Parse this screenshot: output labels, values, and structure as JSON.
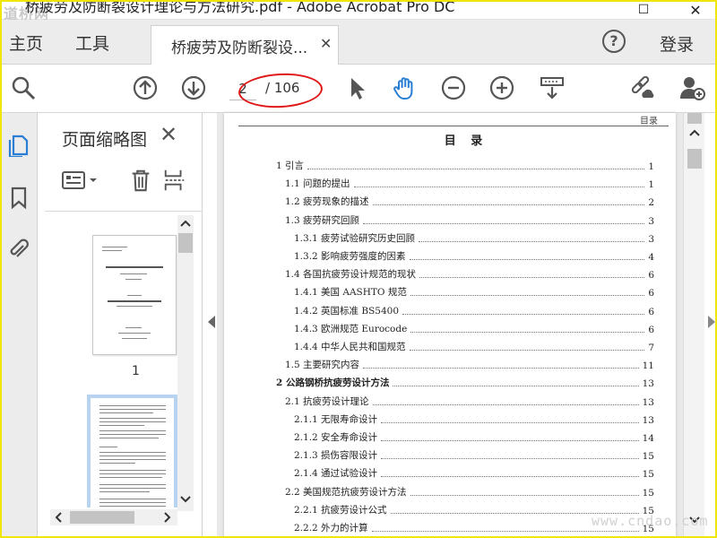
{
  "window": {
    "title": "桥疲劳及防断裂设计理论与方法研究.pdf - Adobe Acrobat Pro DC",
    "watermark_logo": "道桥网"
  },
  "tabs": {
    "home": "主页",
    "tools": "工具",
    "document_tab": "桥疲劳及防断裂设...",
    "login": "登录"
  },
  "toolbar": {
    "current_page": "2",
    "total_pages": "/ 106",
    "icons": [
      "search-icon",
      "page-up-icon",
      "page-down-icon",
      "select-cursor-icon",
      "hand-tool-icon",
      "zoom-out-icon",
      "zoom-in-icon",
      "fit-page-icon",
      "share-link-icon",
      "add-user-icon"
    ]
  },
  "thumbnails": {
    "title": "页面缩略图",
    "page1_number": "1"
  },
  "document": {
    "running_header": "目录",
    "toc_title": "目 录",
    "entries": [
      {
        "text": "1 引言",
        "page": "1",
        "bold": false
      },
      {
        "text": "1.1 问题的提出",
        "page": "1",
        "bold": false
      },
      {
        "text": "1.2 疲劳现象的描述",
        "page": "2",
        "bold": false
      },
      {
        "text": "1.3 疲劳研究回顾",
        "page": "3",
        "bold": false
      },
      {
        "text": "1.3.1 疲劳试验研究历史回顾",
        "page": "3",
        "bold": false
      },
      {
        "text": "1.3.2 影响疲劳强度的因素",
        "page": "4",
        "bold": false
      },
      {
        "text": "1.4 各国抗疲劳设计规范的现状",
        "page": "6",
        "bold": false
      },
      {
        "text": "1.4.1 美国 AASHTO 规范",
        "page": "6",
        "bold": false
      },
      {
        "text": "1.4.2 英国标准 BS5400",
        "page": "6",
        "bold": false
      },
      {
        "text": "1.4.3 欧洲规范 Eurocode",
        "page": "6",
        "bold": false
      },
      {
        "text": "1.4.4 中华人民共和国规范",
        "page": "7",
        "bold": false
      },
      {
        "text": "1.5 主要研究内容",
        "page": "11",
        "bold": false
      },
      {
        "text": "2 公路钢桥抗疲劳设计方法",
        "page": "13",
        "bold": true
      },
      {
        "text": "2.1 抗疲劳设计理论",
        "page": "13",
        "bold": false
      },
      {
        "text": "2.1.1 无限寿命设计",
        "page": "13",
        "bold": false
      },
      {
        "text": "2.1.2 安全寿命设计",
        "page": "14",
        "bold": false
      },
      {
        "text": "2.1.3 损伤容限设计",
        "page": "15",
        "bold": false
      },
      {
        "text": "2.1.4 通过试验设计",
        "page": "15",
        "bold": false
      },
      {
        "text": "2.2 美国规范抗疲劳设计方法",
        "page": "15",
        "bold": false
      },
      {
        "text": "2.2.1 抗疲劳设计公式",
        "page": "15",
        "bold": false
      },
      {
        "text": "2.2.2 外力的计算",
        "page": "15",
        "bold": false
      }
    ]
  },
  "watermark_url": "www.cndao.com",
  "colors": {
    "accent_blue": "#2a7fd4",
    "annotation_red": "#e01818",
    "frame_yellow": "#f2e600"
  }
}
